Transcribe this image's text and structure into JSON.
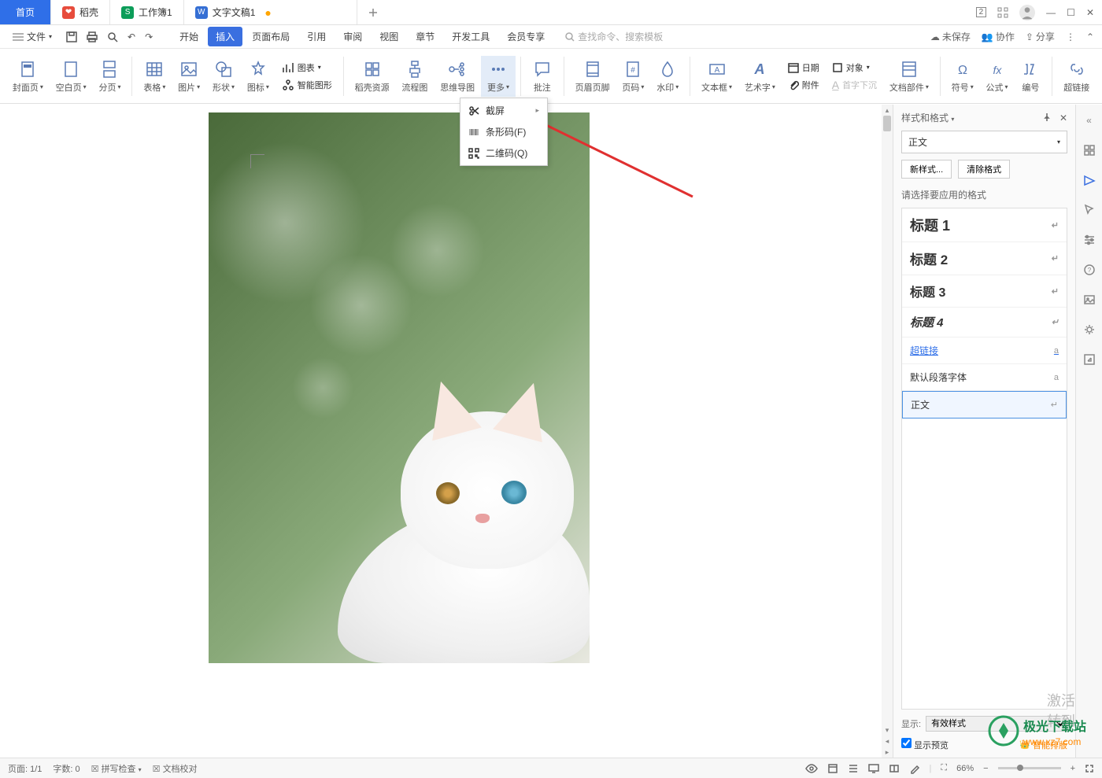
{
  "titlebar": {
    "home": "首页",
    "tabs": [
      {
        "icon": "red",
        "label": "稻壳"
      },
      {
        "icon": "green",
        "label": "工作簿1"
      },
      {
        "icon": "blue",
        "label": "文字文稿1",
        "dirty": true,
        "active": true
      }
    ],
    "layout_badge": "2"
  },
  "menu": {
    "file": "文件",
    "tabs": [
      "开始",
      "插入",
      "页面布局",
      "引用",
      "审阅",
      "视图",
      "章节",
      "开发工具",
      "会员专享"
    ],
    "active_tab": "插入",
    "search_placeholder": "查找命令、搜索模板",
    "right": {
      "unsaved": "未保存",
      "collab": "协作",
      "share": "分享"
    }
  },
  "ribbon": {
    "cover": "封面页",
    "blank": "空白页",
    "pagebreak": "分页",
    "table": "表格",
    "picture": "图片",
    "shape": "形状",
    "icon": "图标",
    "chart": "图表",
    "smartart": "智能图形",
    "resource": "稻壳资源",
    "flowchart": "流程图",
    "mindmap": "思维导图",
    "more": "更多",
    "comment": "批注",
    "headerfooter": "页眉页脚",
    "pagenum": "页码",
    "watermark": "水印",
    "textbox": "文本框",
    "wordart": "艺术字",
    "date": "日期",
    "attachment": "附件",
    "object": "对象",
    "dropcap": "首字下沉",
    "docparts": "文档部件",
    "symbol": "符号",
    "formula": "公式",
    "number": "编号",
    "hyperlink": "超链接"
  },
  "dropdown": {
    "items": [
      {
        "label": "截屏",
        "hasSubmenu": true
      },
      {
        "label": "条形码(F)"
      },
      {
        "label": "二维码(Q)"
      }
    ]
  },
  "panel": {
    "title": "样式和格式",
    "current_style": "正文",
    "new_style": "新样式...",
    "clear": "清除格式",
    "choose": "请选择要应用的格式",
    "styles": [
      {
        "label": "标题 1",
        "cls": "h1"
      },
      {
        "label": "标题 2",
        "cls": "h2"
      },
      {
        "label": "标题 3",
        "cls": "h3"
      },
      {
        "label": "标题 4",
        "cls": "h4"
      },
      {
        "label": "超链接",
        "cls": "link",
        "mark": "a"
      },
      {
        "label": "默认段落字体",
        "cls": "",
        "mark": "a"
      },
      {
        "label": "正文",
        "cls": "sel"
      }
    ],
    "show_label": "显示:",
    "show_value": "有效样式",
    "preview": "显示预览",
    "smart": "智能排版"
  },
  "status": {
    "page": "页面: 1/1",
    "words": "字数: 0",
    "spellcheck": "拼写检查",
    "proofread": "文档校对",
    "zoom": "66%"
  },
  "watermark": {
    "line1": "激活",
    "line2": "转到"
  }
}
